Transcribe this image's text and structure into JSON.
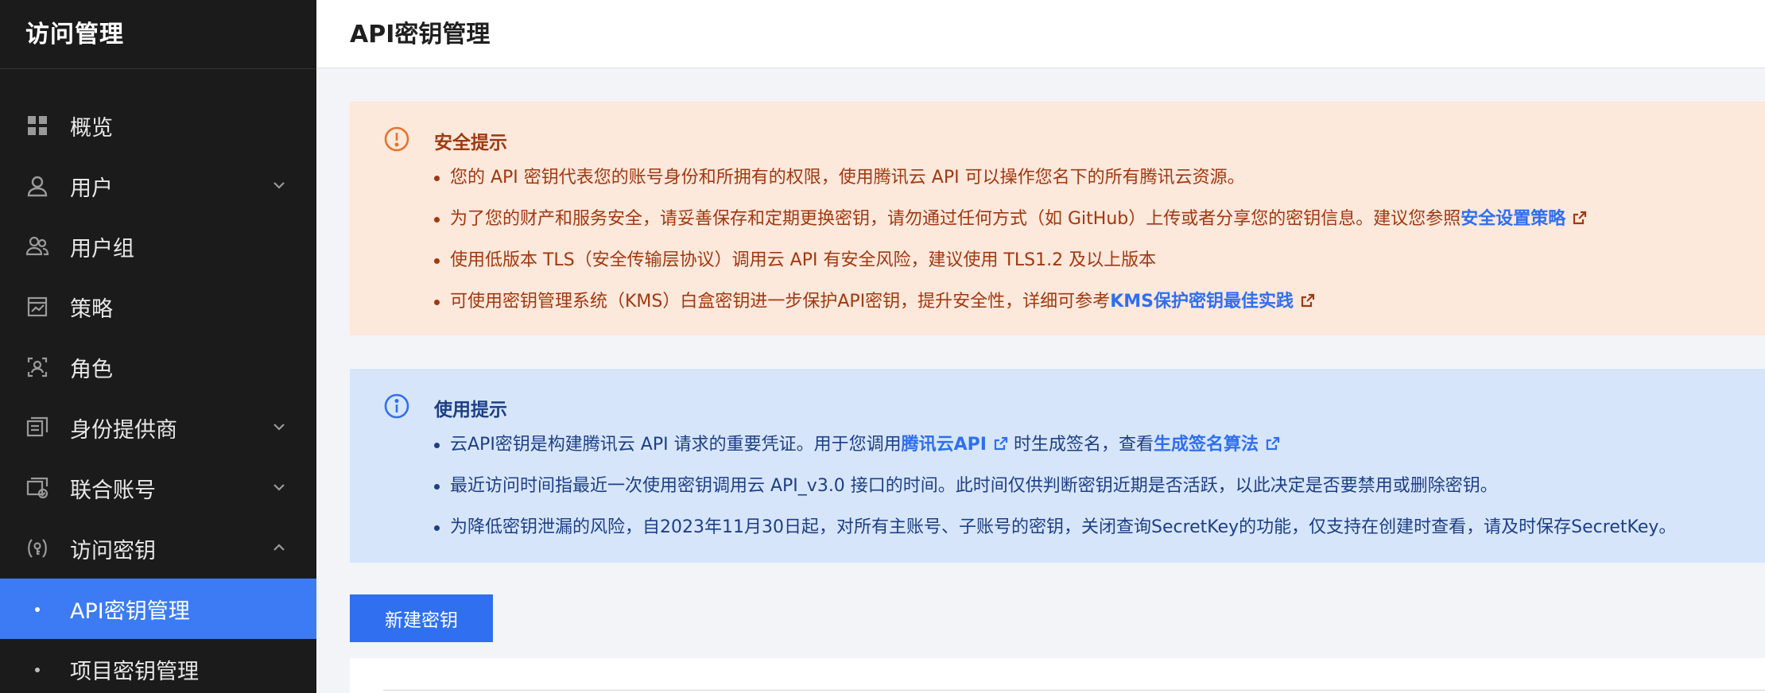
{
  "sidebar": {
    "title": "访问管理",
    "items": [
      {
        "label": "概览",
        "icon": "dashboard-icon",
        "expandable": false
      },
      {
        "label": "用户",
        "icon": "user-icon",
        "expandable": true
      },
      {
        "label": "用户组",
        "icon": "user-group-icon",
        "expandable": false
      },
      {
        "label": "策略",
        "icon": "policy-icon",
        "expandable": false
      },
      {
        "label": "角色",
        "icon": "role-icon",
        "expandable": false
      },
      {
        "label": "身份提供商",
        "icon": "identity-provider-icon",
        "expandable": true
      },
      {
        "label": "联合账号",
        "icon": "federated-account-icon",
        "expandable": true
      },
      {
        "label": "访问密钥",
        "icon": "access-key-icon",
        "expandable": true,
        "expanded": true
      }
    ],
    "subitems": [
      {
        "label": "API密钥管理",
        "active": true
      },
      {
        "label": "项目密钥管理",
        "active": false
      }
    ]
  },
  "header": {
    "title": "API密钥管理"
  },
  "security_alert": {
    "title": "安全提示",
    "items": [
      {
        "text": "您的 API 密钥代表您的账号身份和所拥有的权限，使用腾讯云 API 可以操作您名下的所有腾讯云资源。"
      },
      {
        "text": "为了您的财产和服务安全，请妥善保存和定期更换密钥，请勿通过任何方式（如 GitHub）上传或者分享您的密钥信息。建议您参照",
        "link": "安全设置策略"
      },
      {
        "text": "使用低版本 TLS（安全传输层协议）调用云 API 有安全风险，建议使用 TLS1.2 及以上版本"
      },
      {
        "text": "可使用密钥管理系统（KMS）白盒密钥进一步保护API密钥，提升安全性，详细可参考",
        "link": "KMS保护密钥最佳实践"
      }
    ]
  },
  "usage_alert": {
    "title": "使用提示",
    "item1": {
      "text_a": "云API密钥是构建腾讯云 API 请求的重要凭证。用于您调用",
      "link_a": "腾讯云API",
      "text_b": "时生成签名，查看",
      "link_b": "生成签名算法"
    },
    "item2": "最近访问时间指最近一次使用密钥调用云 API_v3.0 接口的时间。此时间仅供判断密钥近期是否活跃，以此决定是否要禁用或删除密钥。",
    "item3": "为降低密钥泄漏的风险，自2023年11月30日起，对所有主账号、子账号的密钥，关闭查询SecretKey的功能，仅支持在创建时查看，请及时保存SecretKey。"
  },
  "actions": {
    "new_key": "新建密钥"
  },
  "colors": {
    "sidebar_bg": "#1b1b1b",
    "active": "#3d7bf4",
    "primary": "#2f6ff0",
    "warn_bg": "#fde8dc",
    "info_bg": "#d7e5fb"
  }
}
